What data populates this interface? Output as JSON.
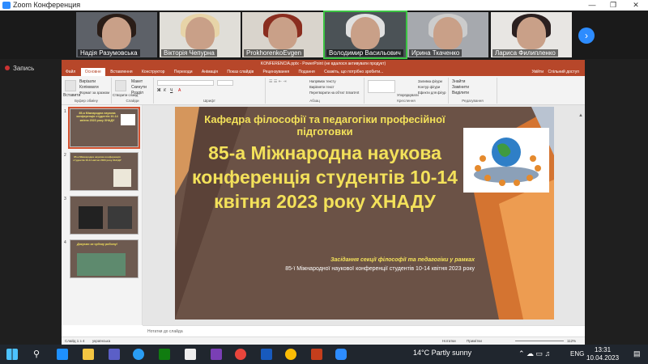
{
  "window": {
    "title": "Zoom Конференция"
  },
  "participants": [
    {
      "name": "Надія Разумовська",
      "hair": "#2a1d17",
      "bg": "#5d6168"
    },
    {
      "name": "Вікторія Чепурна",
      "hair": "#e7d4a8",
      "bg": "#e0ded8"
    },
    {
      "name": "ProkhorenkoEvgen",
      "hair": "#8a2d1f",
      "bg": "#d9d4cc"
    },
    {
      "name": "Володимир Васильович",
      "hair": "#e0e0e0",
      "bg": "#4b5256"
    },
    {
      "name": "Ирина Ткаченко",
      "hair": "#cccccc",
      "bg": "#a6a9ae"
    },
    {
      "name": "Лариса Филипленко",
      "hair": "#2b2020",
      "bg": "#e8e6e3"
    }
  ],
  "recording": {
    "label": "Запись"
  },
  "ppt": {
    "title": "KONFERENCIA.pptx - PowerPoint (не вдалося активувати продукт)",
    "tabs": [
      "Файл",
      "Основне",
      "Вставлення",
      "Конструктор",
      "Переходи",
      "Анімація",
      "Показ слайдів",
      "Рецензування",
      "Подання",
      "Скажіть, що потрібно зробити..."
    ],
    "selected_tab": "Основне",
    "account": "Увійти",
    "share": "Спільний доступ",
    "ribbon": {
      "clipboard": {
        "label": "Буфер обміну",
        "paste": "Вставити",
        "cut": "Вирізати",
        "copy": "Копіювати",
        "format": "Формат за зразком"
      },
      "slides": {
        "label": "Слайди",
        "new": "Створити слайд",
        "layout": "Макет",
        "reset": "Скинути",
        "section": "Розділ"
      },
      "font": {
        "label": "Шрифт"
      },
      "paragraph": {
        "label": "Абзац",
        "direction": "Напрямок тексту",
        "align": "Вирівняти текст",
        "smartart": "Перетворити на об'єкт SmartArt"
      },
      "drawing": {
        "label": "Креслення",
        "arrange": "Упорядкувати",
        "styles": "Експрес-стилі",
        "fill": "Заливка фігури",
        "outline": "Контур фігури",
        "effects": "Ефекти для фігур"
      },
      "editing": {
        "label": "Редагування",
        "find": "Знайти",
        "replace": "Замінити",
        "select": "Виділити"
      }
    },
    "slides": [
      {
        "num": "1",
        "text": "85-а Міжнародна наукова конференція студентів 10-14 квітня 2023 року ХНАДУ"
      },
      {
        "num": "2",
        "text": "85-а Міжнародна наукова конференція студентів 10-14 квітня 2023 року ХНАДУ"
      },
      {
        "num": "3",
        "text": ""
      },
      {
        "num": "4",
        "text": "Дякуємо за чудову роботу!"
      }
    ],
    "current_slide": {
      "title1": "Кафедра філософії та педагогіки професійної підготовки",
      "title2": "85-а Міжнародна наукова конференція студентів 10-14 квітня 2023 року ХНАДУ",
      "sub1": "Засідання секції філософії та педагогіки у рамках",
      "sub2": "85-ї Міжнародної наукової конференції студентів 10-14 квітня 2023 року"
    },
    "notes_placeholder": "Нотатки до слайда",
    "status": {
      "slide": "Слайд 1 з 4",
      "lang": "українська",
      "notes": "Нотатки",
      "comments": "Примітки",
      "zoom": "112%"
    }
  },
  "taskbar": {
    "weather": "14°C  Partly sunny",
    "lang": "ENG",
    "time": "13:31",
    "date": "10.04.2023"
  }
}
